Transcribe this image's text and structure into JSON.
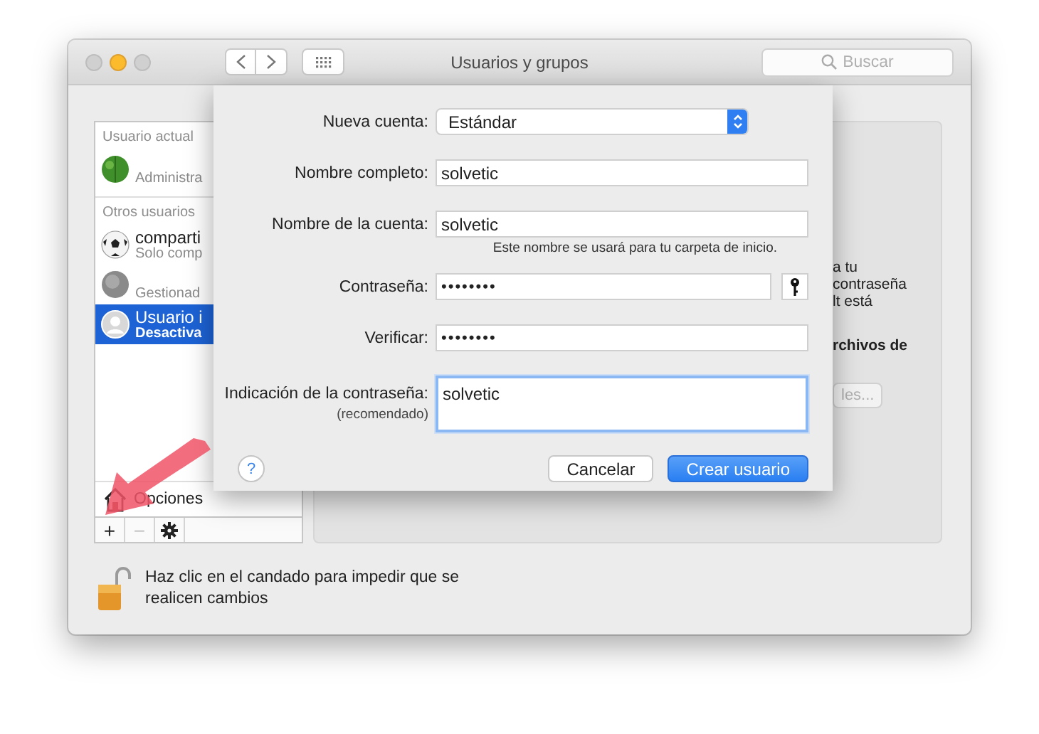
{
  "window": {
    "title": "Usuarios y grupos",
    "traffic_lights": [
      {
        "kind": "close",
        "enabled": false
      },
      {
        "kind": "minimize",
        "enabled": true
      },
      {
        "kind": "zoom",
        "enabled": false
      }
    ]
  },
  "search": {
    "placeholder": "Buscar"
  },
  "sidebar": {
    "sections": [
      {
        "header": "Usuario actual",
        "users": [
          {
            "kind": "leaf",
            "detail": "Administra",
            "selected": false
          }
        ]
      },
      {
        "header": "Otros usuarios",
        "users": [
          {
            "kind": "ball",
            "name": "comparti",
            "detail": "Solo comp",
            "selected": false
          },
          {
            "kind": "gray",
            "detail": "Gestionad",
            "selected": false
          },
          {
            "kind": "person",
            "name": "Usuario i",
            "detail": "Desactiva",
            "selected": true
          }
        ]
      }
    ],
    "options": "Opciones",
    "list_buttons": [
      {
        "label": "+",
        "disabled": false
      },
      {
        "label": "−",
        "disabled": true
      }
    ]
  },
  "right_panel": {
    "lines": [
      {
        "text": "a tu",
        "bold": false
      },
      {
        "text": "contraseña",
        "bold": false
      },
      {
        "text": "lt está",
        "bold": false
      },
      {
        "text": "rchivos de",
        "bold": true
      }
    ],
    "button": {
      "label": "les...",
      "disabled": true
    }
  },
  "lock": {
    "locked": false,
    "text": "Haz clic en el candado para impedir que se realicen cambios"
  },
  "sheet": {
    "fields": [
      {
        "kind": "popup",
        "label": "Nueva cuenta:",
        "value": "Estándar"
      },
      {
        "kind": "text",
        "label": "Nombre completo:",
        "value": "solvetic"
      },
      {
        "kind": "text",
        "label": "Nombre de la cuenta:",
        "value": "solvetic",
        "hint": "Este nombre se usará para tu carpeta de inicio."
      },
      {
        "kind": "password",
        "label": "Contraseña:",
        "value": "••••••••",
        "key_button": true
      },
      {
        "kind": "password",
        "label": "Verificar:",
        "value": "••••••••"
      },
      {
        "kind": "textarea",
        "label": "Indicación de la contraseña:",
        "sublabel": "(recomendado)",
        "value": "solvetic",
        "focused": true
      }
    ],
    "help": "?",
    "buttons": [
      {
        "label": "Cancelar",
        "default": false
      },
      {
        "label": "Crear usuario",
        "default": true
      }
    ]
  }
}
